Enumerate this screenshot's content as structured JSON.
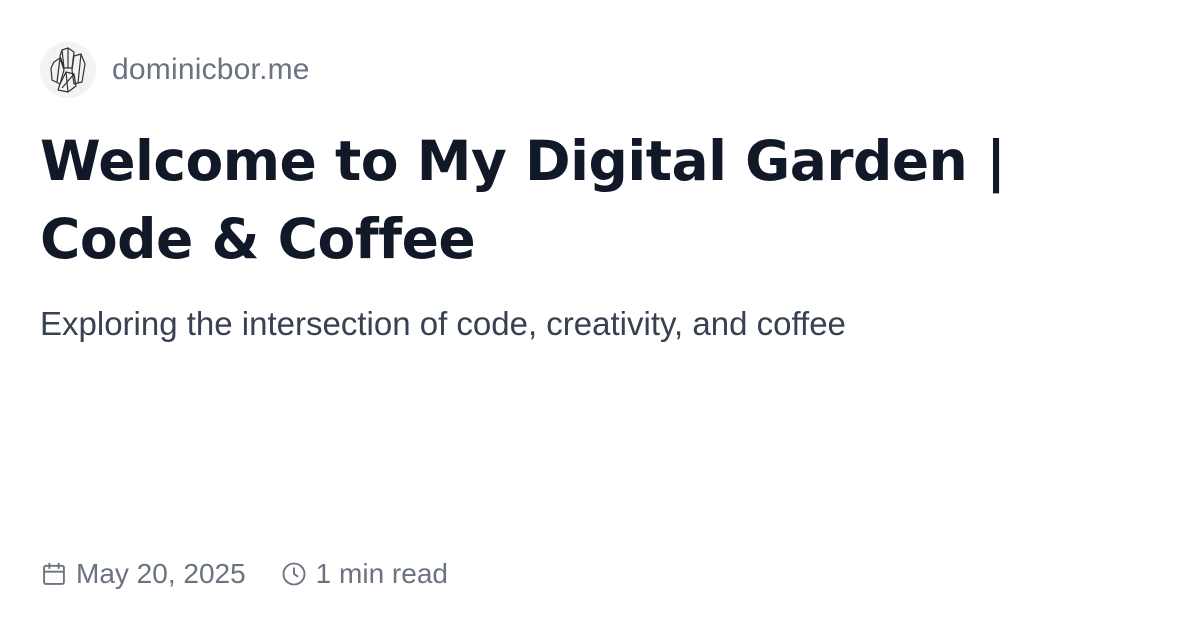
{
  "site": {
    "name": "dominicbor.me",
    "logo_icon": "crystal-icon"
  },
  "post": {
    "title": "Welcome to My Digital Garden | Code & Coffee",
    "description": "Exploring the intersection of code, creativity, and coffee"
  },
  "meta": {
    "date": "May 20, 2025",
    "date_icon": "calendar-icon",
    "read_time": "1 min read",
    "read_time_icon": "clock-icon"
  },
  "colors": {
    "background": "#ffffff",
    "title": "#111827",
    "subtitle": "#374151",
    "muted": "#6b7280"
  }
}
